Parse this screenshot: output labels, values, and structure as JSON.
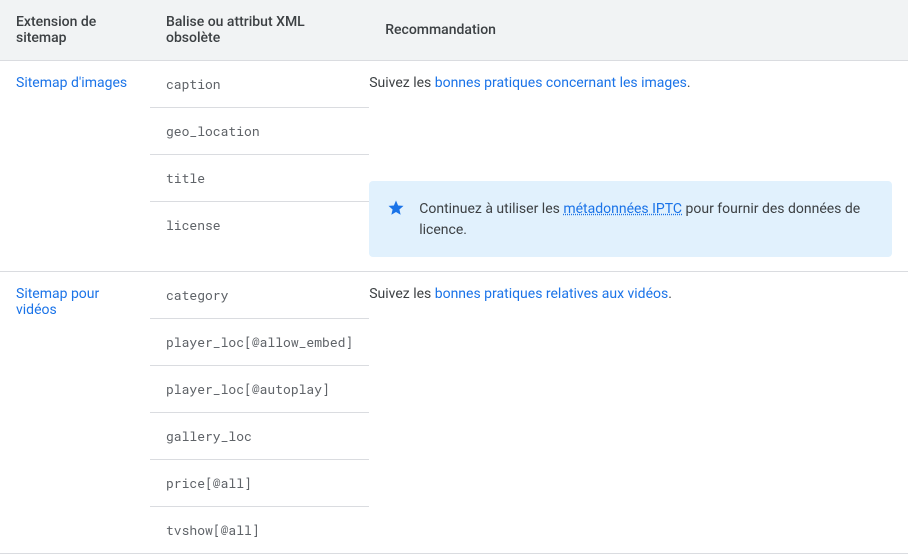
{
  "headers": {
    "ext": "Extension de sitemap",
    "tag": "Balise ou attribut XML obsolète",
    "reco": "Recommandation"
  },
  "rows": [
    {
      "ext_link": "Sitemap d'images",
      "tags": [
        "caption",
        "geo_location",
        "title",
        "license"
      ],
      "reco_prefix": "Suivez les ",
      "reco_link": "bonnes pratiques concernant les images",
      "reco_suffix": ".",
      "note": {
        "prefix": "Continuez à utiliser les ",
        "link": "métadonnées IPTC",
        "suffix": " pour fournir des données de licence."
      }
    },
    {
      "ext_link": "Sitemap pour vidéos",
      "tags": [
        "category",
        "player_loc[@allow_embed]",
        "player_loc[@autoplay]",
        "gallery_loc",
        "price[@all]",
        "tvshow[@all]"
      ],
      "reco_prefix": "Suivez les ",
      "reco_link": "bonnes pratiques relatives aux vidéos",
      "reco_suffix": "."
    }
  ]
}
